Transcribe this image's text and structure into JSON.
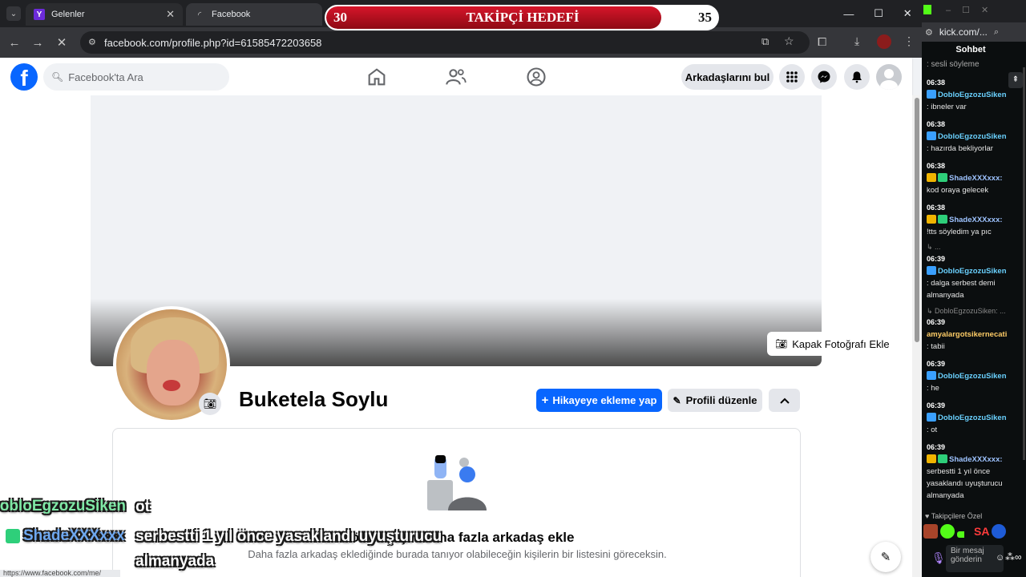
{
  "browser": {
    "tabs": [
      {
        "label": "Gelenler",
        "icon": "yahoo-mail-icon"
      },
      {
        "label": "Facebook",
        "icon": "loading-icon"
      }
    ],
    "url": "facebook.com/profile.php?id=61585472203658",
    "status_url": "https://www.facebook.com/me/"
  },
  "goal": {
    "title": "TAKİPÇİ HEDEFİ",
    "current": "30",
    "target": "35",
    "progress": 0.857
  },
  "facebook": {
    "search_placeholder": "Facebook'ta Ara",
    "find_friends": "Arkadaşlarını bul",
    "cover_button": "Kapak Fotoğrafı Ekle",
    "profile_name": "Buketela Soylu",
    "add_story": "Hikayeye ekleme yap",
    "edit_profile": "Profili düzenle",
    "pymk_title": "Görmek için daha fazla arkadaş ekle",
    "pymk_sub": "Daha fazla arkadaş eklediğinde burada tanıyor olabileceğin kişilerin bir listesini göreceksin."
  },
  "overlay": {
    "line1_user": "DobloEgzozuSiken",
    "line1_msg": "ot",
    "line2_user": "ShadeXXXxxx",
    "line2_msg_a": "serbestti 1 yıl önce yasaklandı uyuşturucu",
    "line2_msg_b": "almanyada"
  },
  "chat": {
    "address": "kick.com/...",
    "title": "Sohbet",
    "top_fragment": ": sesli söyleme",
    "messages": [
      {
        "time": "06:38",
        "user": "DobloEgzozuSiken",
        "text": ": ibneler var"
      },
      {
        "time": "06:38",
        "user": "DobloEgzozuSiken",
        "text": ": hazırda bekliyorlar"
      },
      {
        "time": "06:38",
        "user": "ShadeXXXxxx:",
        "text": "kod oraya gelecek"
      },
      {
        "time": "06:38",
        "user": "ShadeXXXxxx:",
        "text": "!tts söyledim ya pıc"
      },
      {
        "time": "06:39",
        "user": "DobloEgzozuSiken",
        "text": ": dalga serbest demi almanyada"
      },
      {
        "time": "06:39",
        "user": "amyalargotsikernecati",
        "text": ": tabii"
      },
      {
        "time": "06:39",
        "user": "DobloEgzozuSiken",
        "text": ": he"
      },
      {
        "time": "06:39",
        "user": "DobloEgzozuSiken",
        "text": ": ot"
      },
      {
        "time": "06:39",
        "user": "ShadeXXXxxx:",
        "text": "serbestti 1 yıl önce yasaklandı uyuşturucu almanyada"
      }
    ],
    "reply1": "↳ ...",
    "reply2": "↳ DobloEgzozuSiken: ...",
    "followers_only": "Takipçilere Özel",
    "emote_text": "SA",
    "input_placeholder": "Bir mesaj gönderin"
  },
  "colors": {
    "fb_blue": "#0866ff",
    "kick_green": "#53fc18",
    "goal_red": "#d6152a"
  }
}
